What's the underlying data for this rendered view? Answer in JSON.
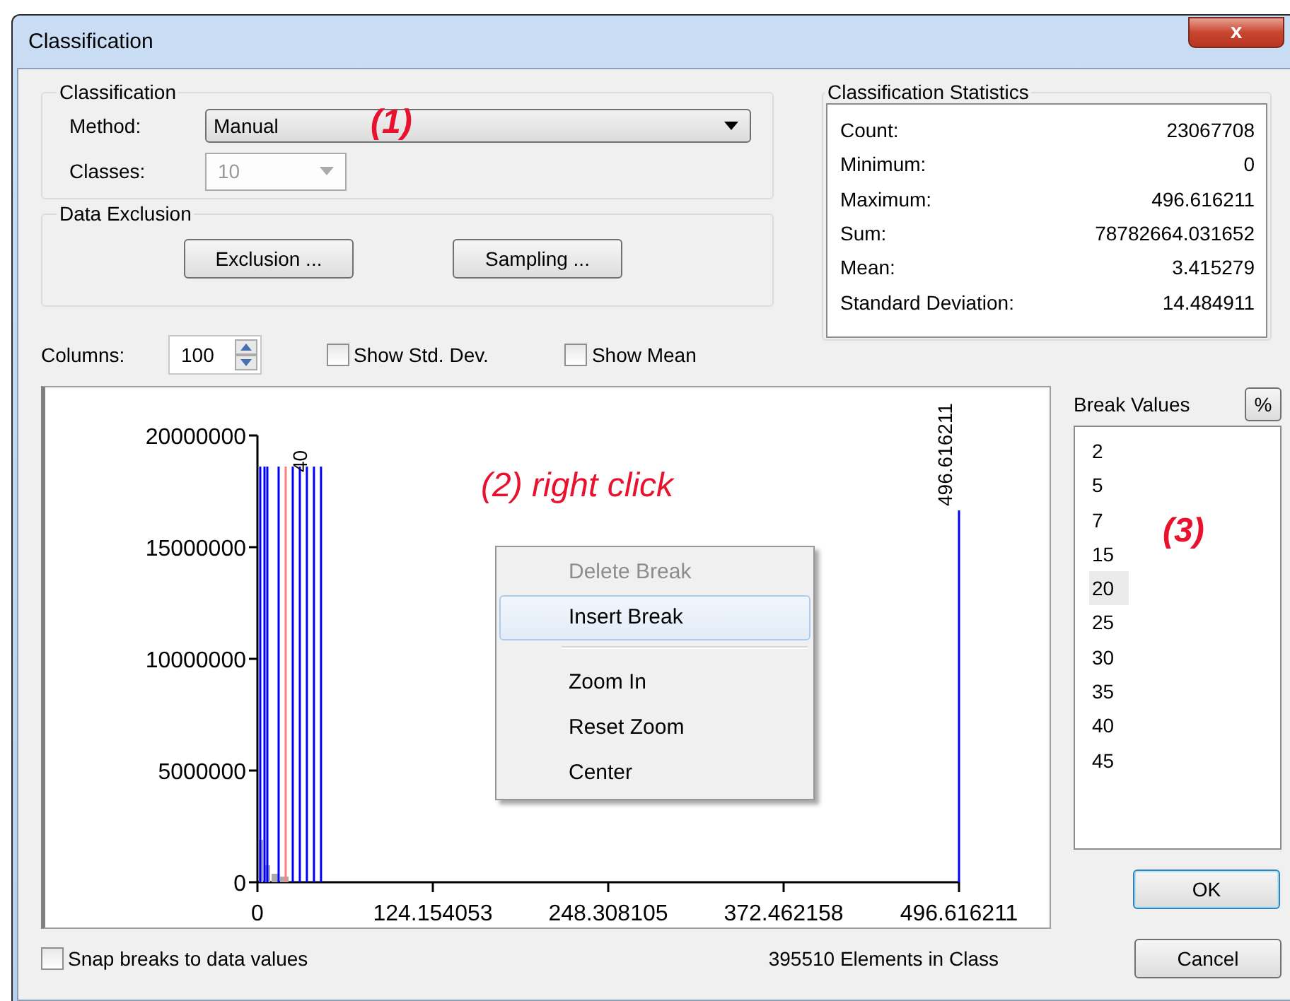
{
  "window": {
    "title": "Classification",
    "close_label": "x"
  },
  "classification": {
    "title": "Classification",
    "method_label": "Method:",
    "method_value": "Manual",
    "classes_label": "Classes:",
    "classes_value": "10",
    "classes_disabled": true
  },
  "data_exclusion": {
    "title": "Data Exclusion",
    "buttons": [
      "Exclusion ...",
      "Sampling ..."
    ]
  },
  "statistics": {
    "title": "Classification Statistics",
    "rows": [
      {
        "label": "Count:",
        "value": "23067708"
      },
      {
        "label": "Minimum:",
        "value": "0"
      },
      {
        "label": "Maximum:",
        "value": "496.616211"
      },
      {
        "label": "Sum:",
        "value": "78782664.031652"
      },
      {
        "label": "Mean:",
        "value": "3.415279"
      },
      {
        "label": "Standard Deviation:",
        "value": "14.484911"
      }
    ]
  },
  "columns": {
    "label": "Columns:",
    "value": "100"
  },
  "checkboxes": [
    {
      "label": "Show Std. Dev.",
      "checked": false
    },
    {
      "label": "Show Mean",
      "checked": false
    }
  ],
  "chart": {
    "y_tick_labels": [
      "20000000",
      "15000000",
      "10000000",
      "5000000",
      "0"
    ],
    "x_tick_labels": [
      "0",
      "124.154053",
      "248.308105",
      "372.462158",
      "496.616211"
    ],
    "break_line_labels": [
      "40",
      "496.616211"
    ]
  },
  "context_menu": {
    "items": [
      {
        "kind": "item",
        "label": "Delete Break",
        "disabled": true,
        "selected": false
      },
      {
        "kind": "item",
        "label": "Insert Break",
        "disabled": false,
        "selected": true
      },
      {
        "kind": "separator"
      },
      {
        "kind": "item",
        "label": "Zoom In",
        "disabled": false,
        "selected": false
      },
      {
        "kind": "item",
        "label": "Reset Zoom",
        "disabled": false,
        "selected": false
      },
      {
        "kind": "item",
        "label": "Center",
        "disabled": false,
        "selected": false
      }
    ]
  },
  "break_values": {
    "label": "Break Values",
    "percent_button": "%",
    "items": [
      {
        "value": "2",
        "selected": false
      },
      {
        "value": "5",
        "selected": false
      },
      {
        "value": "7",
        "selected": false
      },
      {
        "value": "15",
        "selected": false
      },
      {
        "value": "20",
        "selected": true
      },
      {
        "value": "25",
        "selected": false
      },
      {
        "value": "30",
        "selected": false
      },
      {
        "value": "35",
        "selected": false
      },
      {
        "value": "40",
        "selected": false
      },
      {
        "value": "45",
        "selected": false
      }
    ]
  },
  "annotations": [
    "(1)",
    "(2) right click",
    "(3)"
  ],
  "snap_checkbox": {
    "label": "Snap breaks to data values",
    "checked": false
  },
  "status": "395510 Elements in Class",
  "buttons": [
    "OK",
    "Cancel"
  ]
}
